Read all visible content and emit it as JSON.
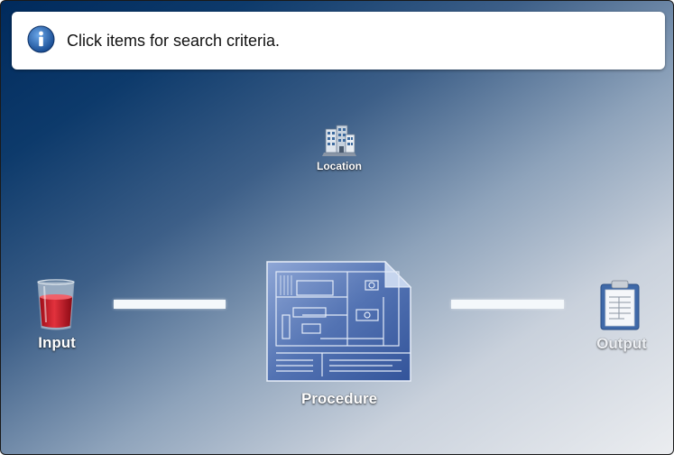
{
  "info_bar": {
    "icon": "info-icon",
    "message": "Click items for search criteria."
  },
  "nodes": {
    "location": {
      "label": "Location",
      "icon": "building-icon"
    },
    "input": {
      "label": "Input",
      "icon": "glass-icon"
    },
    "procedure": {
      "label": "Procedure",
      "icon": "blueprint-icon"
    },
    "output": {
      "label": "Output",
      "icon": "clipboard-icon"
    }
  },
  "colors": {
    "background_dark": "#002a5c",
    "background_light": "#ebedf0",
    "info_icon": "#1f5fa8",
    "connector": "#f4f8fb"
  }
}
